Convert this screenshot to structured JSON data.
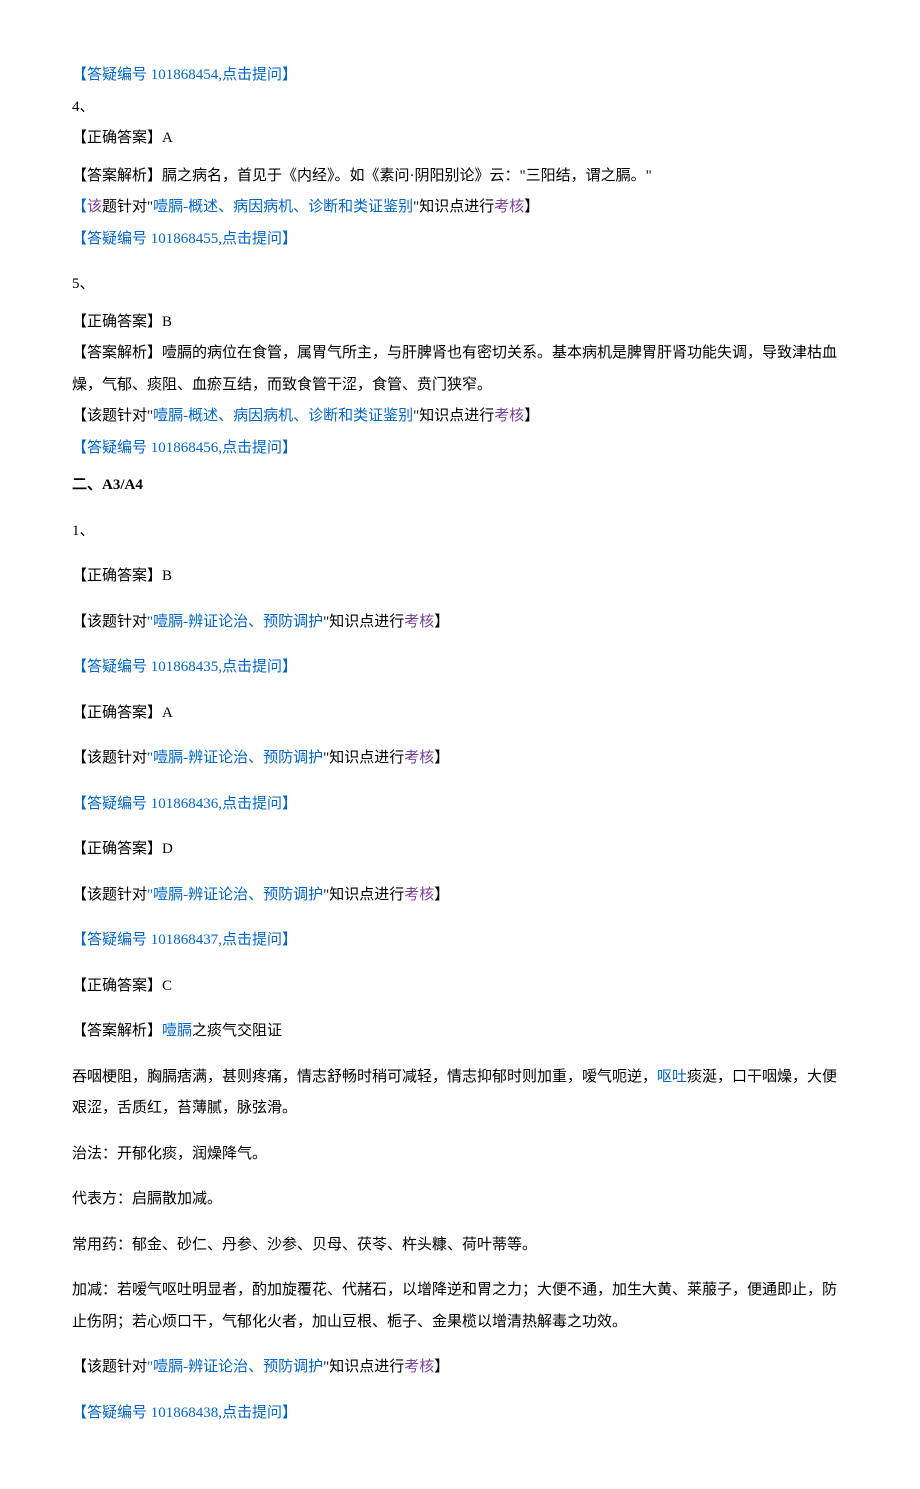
{
  "top": {
    "refid_3": "【答疑编号 101868454,点击提问】"
  },
  "q4": {
    "num": "4、",
    "correct_label": "【正确答案】",
    "correct_value": "A",
    "analysis_label": "【答案解析】",
    "analysis_text": "膈之病名，首见于《内经》。如《素问·阴阳别论》云：\"三阳结，谓之膈。\"",
    "topic_l1": "【",
    "topic_l2": "该",
    "topic_mid": "题针对\"",
    "topic_link": "噎膈-概述、病因病机、诊断和类证鉴别",
    "topic_tail1": "\"知识点进行",
    "topic_tail2": "考核",
    "topic_tail3": "】",
    "refid": "【答疑编号 101868455,点击提问】"
  },
  "q5": {
    "num": "5、",
    "correct_label": "【正确答案】",
    "correct_value": "B",
    "analysis_label": "【答案解析】",
    "analysis_text": "噎膈的病位在食管，属胃气所主，与肝脾肾也有密切关系。基本病机是脾胃肝肾功能失调，导致津枯血燥，气郁、痰阻、血瘀互结，而致食管干涩，食管、贲门狭窄。",
    "topic_l1": "【该题针对\"",
    "topic_link": "噎膈-概述、病因病机、诊断和类证鉴别",
    "topic_tail1": "\"知识点进行",
    "topic_tail2": "考核",
    "topic_tail3": "】",
    "refid": "【答疑编号 101868456,点击提问】"
  },
  "section2": {
    "title": "二、A3/A4",
    "num": "1、",
    "a1": {
      "correct_label": "【正确答案】",
      "correct_value": "B",
      "topic_pre": "【该题针对",
      "topic_q": "\"",
      "topic_link": "噎膈-辨证论治、预防调护",
      "topic_tail1": "\"知识点进行",
      "topic_tail2": "考核",
      "topic_tail3": "】",
      "refid": "【答疑编号 101868435,点击提问】"
    },
    "a2": {
      "correct_label": "【正确答案】",
      "correct_value": "A",
      "topic_pre": "【该题针对",
      "topic_q": "\"",
      "topic_link": "噎膈-辨证论治、预防调护",
      "topic_tail1": "\"知识点进行",
      "topic_tail2": "考核",
      "topic_tail3": "】",
      "refid": "【答疑编号 101868436,点击提问】"
    },
    "a3": {
      "correct_label": "【正确答案】",
      "correct_value": "D",
      "topic_pre": "【该题针对",
      "topic_q": "\"",
      "topic_link": "噎膈-辨证论治、预防调护",
      "topic_tail1": "\"知识点进行",
      "topic_tail2": "考核",
      "topic_tail3": "】",
      "refid": "【答疑编号 101868437,点击提问】"
    },
    "a4": {
      "correct_label": "【正确答案】",
      "correct_value": "C",
      "analysis_label": "【答案解析】",
      "analysis_link": "噎膈",
      "analysis_tail": "之痰气交阻证",
      "body1a": "吞咽梗阻，胸膈痞满，甚则疼痛，情志舒畅时稍可减轻，情志抑郁时则加重，嗳气呃逆，",
      "body1b": "呕吐",
      "body1c": "痰涎，口干咽燥，大便艰涩，舌质红，苔薄腻，脉弦滑。",
      "body2": "治法：开郁化痰，润燥降气。",
      "body3": "代表方：启膈散加减。",
      "body4": "常用药：郁金、砂仁、丹参、沙参、贝母、茯苓、杵头糠、荷叶蒂等。",
      "body5": "加减：若嗳气呕吐明显者，酌加旋覆花、代赭石，以增降逆和胃之力；大便不通，加生大黄、莱菔子，便通即止，防止伤阴；若心烦口干，气郁化火者，加山豆根、栀子、金果榄以增清热解毒之功效。",
      "topic_pre": "【该题针对",
      "topic_q": "\"",
      "topic_link": "噎膈-辨证论治、预防调护",
      "topic_tail1": "\"知识点进行",
      "topic_tail2": "考核",
      "topic_tail3": "】",
      "refid": "【答疑编号 101868438,点击提问】"
    }
  }
}
